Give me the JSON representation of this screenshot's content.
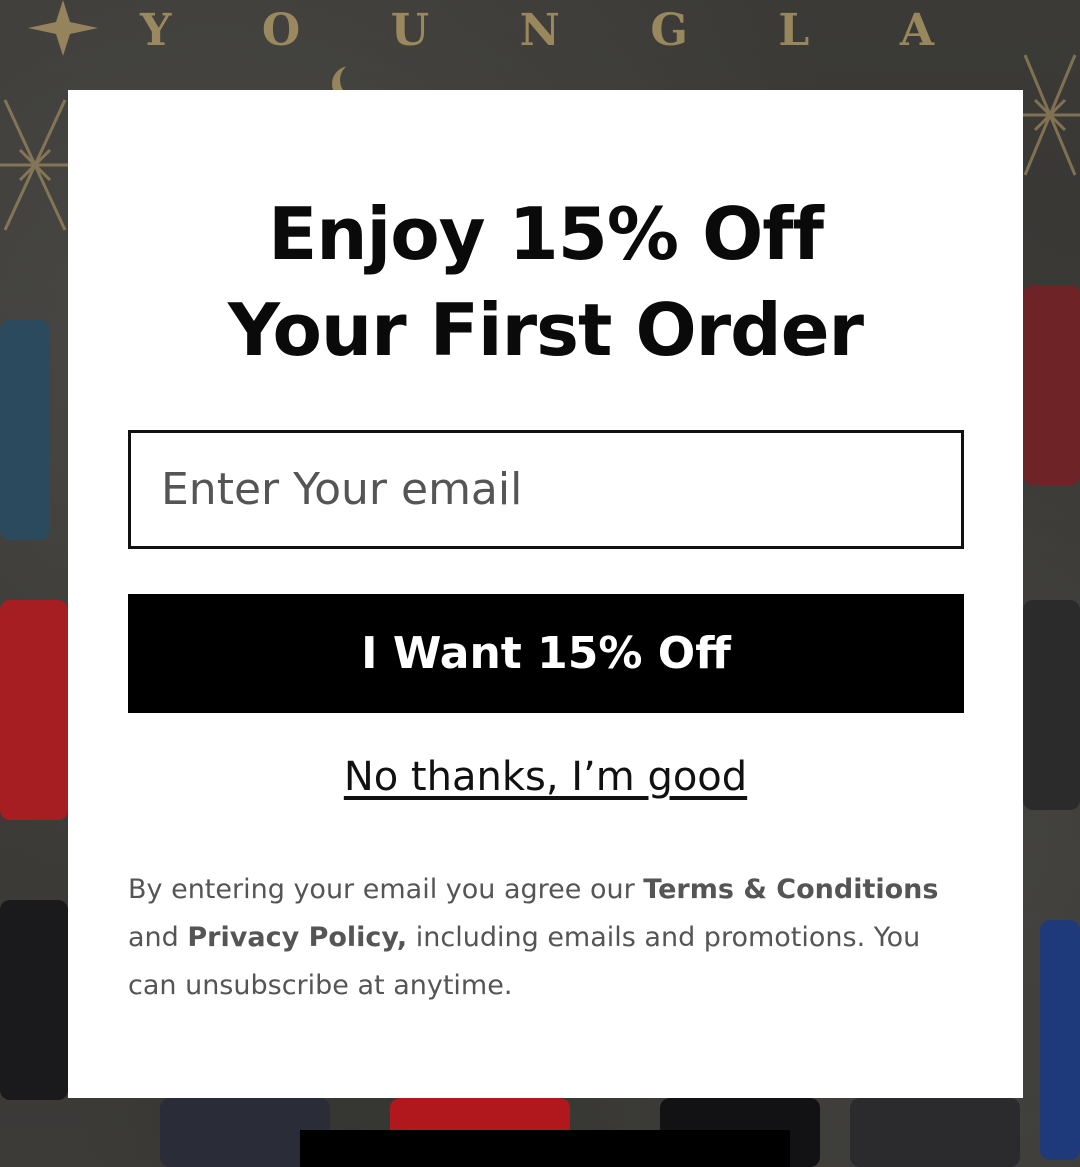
{
  "background": {
    "brand_letters": [
      "Y",
      "O",
      "U",
      "N",
      "G",
      "L",
      "A"
    ],
    "accent_color": "#b8a06a"
  },
  "popup": {
    "headline_line1": "Enjoy 15% Off",
    "headline_line2": "Your First Order",
    "email_placeholder": "Enter Your email",
    "cta_label": "I Want 15% Off",
    "decline_label": "No thanks, I’m good",
    "disclaimer": {
      "part1": "By entering your email you agree our ",
      "terms_link": "Terms & Conditions",
      "part2": " and ",
      "privacy_link": "Privacy Policy,",
      "part3": " including emails and promotions. You can unsubscribe at anytime."
    }
  },
  "colors": {
    "popup_bg": "#ffffff",
    "button_bg": "#000000",
    "button_text": "#ffffff",
    "text_dark": "#0a0a0a",
    "text_muted": "#555555"
  }
}
